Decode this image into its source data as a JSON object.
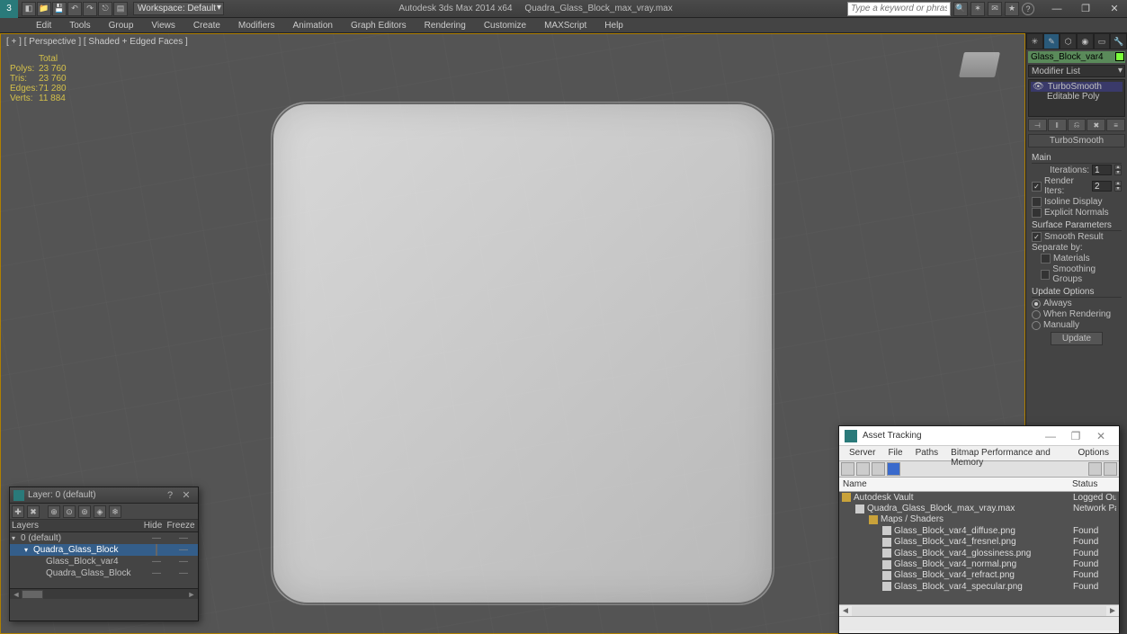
{
  "title": {
    "app": "Autodesk 3ds Max  2014 x64",
    "file": "Quadra_Glass_Block_max_vray.max"
  },
  "workspace": {
    "label": "Workspace: Default"
  },
  "search": {
    "placeholder": "Type a keyword or phrase"
  },
  "menu": [
    "Edit",
    "Tools",
    "Group",
    "Views",
    "Create",
    "Modifiers",
    "Animation",
    "Graph Editors",
    "Rendering",
    "Customize",
    "MAXScript",
    "Help"
  ],
  "viewport": {
    "label": "[ + ] [ Perspective ] [ Shaded + Edged Faces ]"
  },
  "stats": {
    "title": "Total",
    "rows": [
      {
        "k": "Polys:",
        "v": "23 760"
      },
      {
        "k": "Tris:",
        "v": "23 760"
      },
      {
        "k": "Edges:",
        "v": "71 280"
      },
      {
        "k": "Verts:",
        "v": "11 884"
      }
    ]
  },
  "cmd": {
    "obj": "Glass_Block_var4",
    "modlist": "Modifier List",
    "stack": [
      "TurboSmooth",
      "Editable Poly"
    ],
    "rollout": "TurboSmooth",
    "main": "Main",
    "iter_label": "Iterations:",
    "iter_val": "1",
    "render_label": "Render Iters:",
    "render_val": "2",
    "isoline": "Isoline Display",
    "normals": "Explicit Normals",
    "surf_hdr": "Surface Parameters",
    "smooth_res": "Smooth Result",
    "separate": "Separate by:",
    "mat": "Materials",
    "sg": "Smoothing Groups",
    "upd_hdr": "Update Options",
    "upd_opts": [
      "Always",
      "When Rendering",
      "Manually"
    ],
    "update_btn": "Update"
  },
  "layer_dlg": {
    "title": "Layer: 0 (default)",
    "cols": {
      "layers": "Layers",
      "hide": "Hide",
      "freeze": "Freeze"
    },
    "rows": [
      {
        "indent": 0,
        "name": "0 (default)",
        "sel": false,
        "exp": "▾",
        "hide": "dash",
        "freeze": "dash"
      },
      {
        "indent": 1,
        "name": "Quadra_Glass_Block",
        "sel": true,
        "exp": "▾",
        "hide": "box",
        "freeze": "dash"
      },
      {
        "indent": 2,
        "name": "Glass_Block_var4",
        "sel": false,
        "exp": "",
        "hide": "dash",
        "freeze": "dash"
      },
      {
        "indent": 2,
        "name": "Quadra_Glass_Block",
        "sel": false,
        "exp": "",
        "hide": "dash",
        "freeze": "dash"
      }
    ]
  },
  "asset_dlg": {
    "title": "Asset Tracking",
    "menu": [
      "Server",
      "File",
      "Paths",
      "Bitmap Performance and Memory",
      "Options"
    ],
    "cols": {
      "name": "Name",
      "status": "Status"
    },
    "rows": [
      {
        "indent": 0,
        "icon": "folder",
        "name": "Autodesk Vault",
        "status": "Logged Out"
      },
      {
        "indent": 1,
        "icon": "file",
        "name": "Quadra_Glass_Block_max_vray.max",
        "status": "Network Pa"
      },
      {
        "indent": 2,
        "icon": "folder",
        "name": "Maps / Shaders",
        "status": ""
      },
      {
        "indent": 3,
        "icon": "file",
        "name": "Glass_Block_var4_diffuse.png",
        "status": "Found"
      },
      {
        "indent": 3,
        "icon": "file",
        "name": "Glass_Block_var4_fresnel.png",
        "status": "Found"
      },
      {
        "indent": 3,
        "icon": "file",
        "name": "Glass_Block_var4_glossiness.png",
        "status": "Found"
      },
      {
        "indent": 3,
        "icon": "file",
        "name": "Glass_Block_var4_normal.png",
        "status": "Found"
      },
      {
        "indent": 3,
        "icon": "file",
        "name": "Glass_Block_var4_refract.png",
        "status": "Found"
      },
      {
        "indent": 3,
        "icon": "file",
        "name": "Glass_Block_var4_specular.png",
        "status": "Found"
      }
    ]
  }
}
